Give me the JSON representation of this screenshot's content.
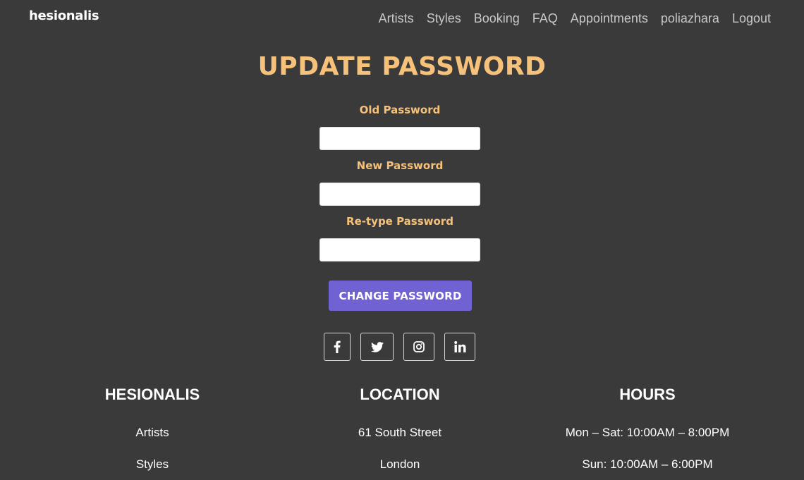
{
  "nav": {
    "brand": "hesionalis",
    "links": [
      "Artists",
      "Styles",
      "Booking",
      "FAQ",
      "Appointments",
      "poliazhara",
      "Logout"
    ]
  },
  "page": {
    "title": "UPDATE PASSWORD"
  },
  "form": {
    "old_label": "Old Password",
    "new_label": "New Password",
    "retype_label": "Re-type Password",
    "old_value": "",
    "new_value": "",
    "retype_value": "",
    "submit_label": "CHANGE PASSWORD"
  },
  "socials": [
    {
      "icon": "facebook-icon"
    },
    {
      "icon": "twitter-icon"
    },
    {
      "icon": "instagram-icon"
    },
    {
      "icon": "linkedin-icon"
    }
  ],
  "footer": {
    "col1": {
      "title": "HESIONALIS",
      "lines": [
        "Artists",
        "Styles"
      ]
    },
    "col2": {
      "title": "LOCATION",
      "lines": [
        "61 South Street",
        "London"
      ]
    },
    "col3": {
      "title": "HOURS",
      "lines": [
        "Mon – Sat: 10:00AM – 8:00PM",
        "Sun: 10:00AM – 6:00PM"
      ]
    }
  },
  "colors": {
    "background": "#3a3a3a",
    "accent": "#f6c27a",
    "button": "#7162d4",
    "nav_text": "#c8c8c8"
  }
}
